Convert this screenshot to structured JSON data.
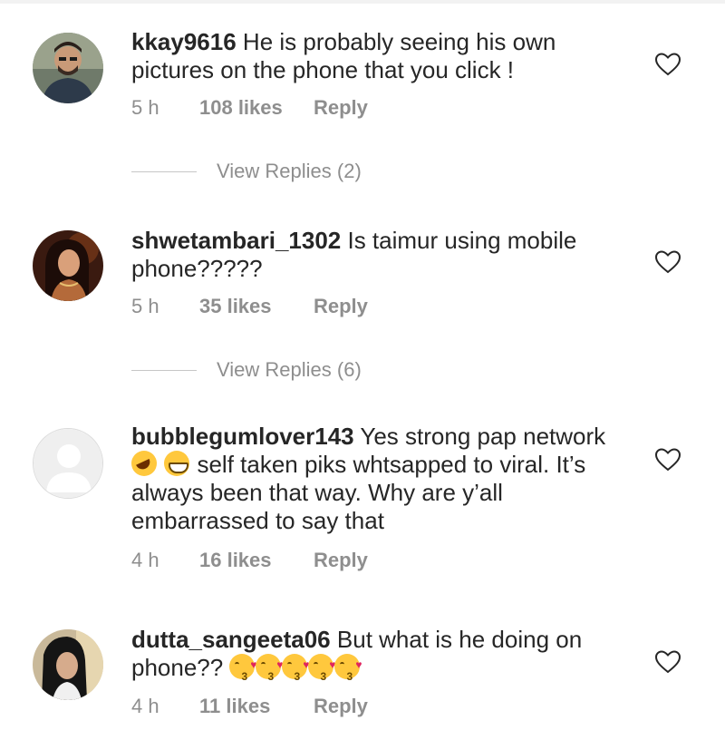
{
  "comments": [
    {
      "username": "kkay9616",
      "text": "He is probably seeing his own pictures on the phone  that you click !",
      "time": "5 h",
      "likes": "108 likes",
      "reply": "Reply",
      "view_replies": "View Replies (2)",
      "avatar": "man-photo"
    },
    {
      "username": "shwetambari_1302",
      "text": "Is taimur using mobile phone?????",
      "time": "5 h",
      "likes": "35 likes",
      "reply": "Reply",
      "view_replies": "View Replies (6)",
      "avatar": "woman-photo"
    },
    {
      "username": "bubblegumlover143",
      "text_before_emoji": "Yes strong pap network",
      "text_after_emoji": "self taken piks whtsapped to viral. It’s always been that way. Why are y’all embarrassed to say that",
      "emojis": [
        "rolling-on-floor-laughing",
        "grinning-squinting-face"
      ],
      "time": "4 h",
      "likes": "16 likes",
      "reply": "Reply",
      "avatar": "default-profile"
    },
    {
      "username": "dutta_sangeeta06",
      "text": "But what is he doing on phone??",
      "emojis": [
        "face-blowing-kiss",
        "face-blowing-kiss",
        "face-blowing-kiss",
        "face-blowing-kiss",
        "face-blowing-kiss"
      ],
      "time": "4 h",
      "likes": "11 likes",
      "reply": "Reply",
      "avatar": "woman-photo"
    }
  ],
  "icons": {
    "like": "heart-outline-icon"
  },
  "colors": {
    "text": "#262626",
    "meta": "#8e8e8e",
    "divider": "#c7c7c7"
  }
}
